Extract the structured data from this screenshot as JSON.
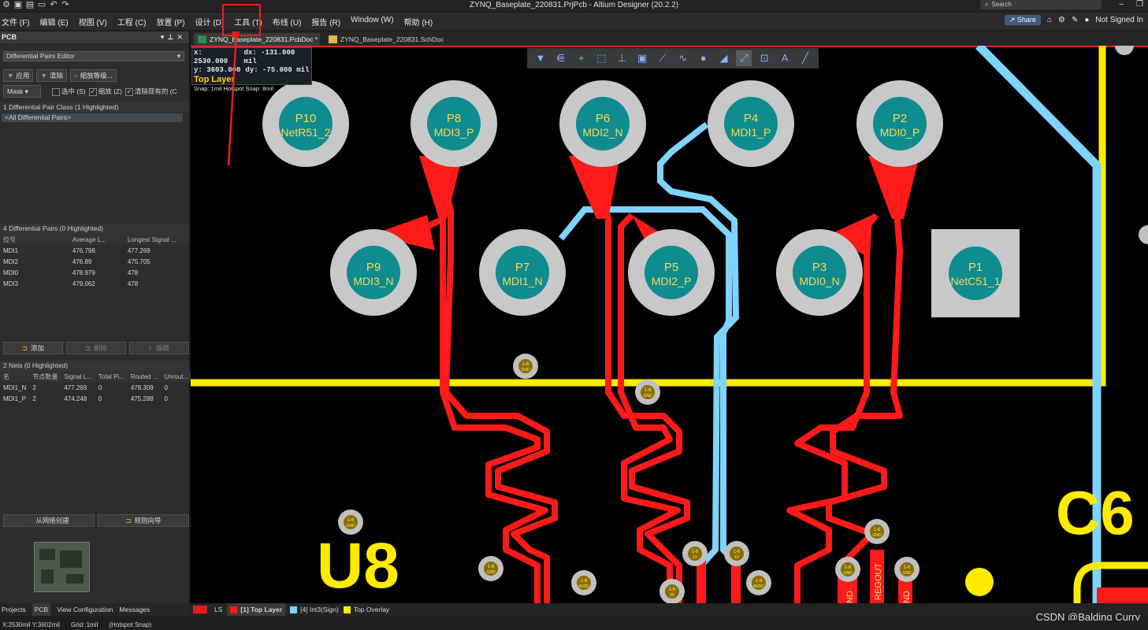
{
  "app": {
    "title": "ZYNQ_Baseplate_220831.PrjPcb - Altium Designer (20.2.2)",
    "search_placeholder": "Search",
    "share_label": "Share",
    "user_label": "Not Signed In"
  },
  "menu": [
    "文件 (F)",
    "编辑 (E)",
    "视图 (V)",
    "工程 (C)",
    "放置 (P)",
    "设计 (D)",
    "工具 (T)",
    "布线 (U)",
    "报告 (R)",
    "Window (W)",
    "帮助 (H)"
  ],
  "panel": {
    "title": "PCB",
    "mode": "Differential Pairs Editor",
    "apply_label": "应用",
    "clear_label": "清除",
    "zoom_label": "缩放等级...",
    "mask_label": "Mask",
    "select_label": "选中 (S)",
    "zoom_chk_label": "缩放 (Z)",
    "clear_existing_label": "清除现有的 (C",
    "class_header": "1 Differential Pair Class (1 Highlighted)",
    "class_item": "<All Differential Pairs>",
    "pairs_header": "4 Differential Pairs (0 Highlighted)",
    "pairs_cols": [
      "位号",
      "Average L...",
      "Longest Signal ..."
    ],
    "pairs": [
      {
        "name": "MDI1",
        "avg": "476.798",
        "longest": "477.269"
      },
      {
        "name": "MDI2",
        "avg": "476.89",
        "longest": "475.705"
      },
      {
        "name": "MDI0",
        "avg": "478.979",
        "longest": "478"
      },
      {
        "name": "MDI3",
        "avg": "479.062",
        "longest": "478"
      }
    ],
    "add_label": "添加",
    "btn2_label": "删除",
    "btn3_label": "编辑",
    "nets_header": "2 Nets (0 Highlighted)",
    "nets_cols": [
      "名",
      "节点数量",
      "Signal L...",
      "Total Pi...",
      "Routed ...",
      "Unrout..."
    ],
    "nets": [
      {
        "name": "MDI1_N",
        "nodes": "2",
        "signal": "477.269",
        "total": "0",
        "routed": "478.309",
        "unrouted": "0"
      },
      {
        "name": "MDI1_P",
        "nodes": "2",
        "signal": "474.248",
        "total": "0",
        "routed": "475.288",
        "unrouted": "0"
      }
    ],
    "from_net_label": "从网络创建",
    "rule_wizard_label": "规则向导"
  },
  "left_tabs": [
    "Projects",
    "PCB",
    "View Configuration",
    "Messages"
  ],
  "doc_tabs": [
    "ZYNQ_Baseplate_220831.PcbDoc *",
    "ZYNQ_Baseplate_220831.SchDoc"
  ],
  "coords": {
    "x": "x: 2530.000",
    "dx": "dx: -131.000 mil",
    "y": "y: 3603.000",
    "dy": "dy:  -75.000 mil",
    "layer": "Top Layer",
    "snap": "Snap: 1mil Hotspot Snap: 8mil"
  },
  "layers": {
    "ls_label": "LS",
    "top": "[1] Top Layer",
    "int3": "[4] Int3(Sign)",
    "overlay": "Top Overlay",
    "colors": {
      "top": "#ff1a1a",
      "int3": "#7fd3ff",
      "overlay": "#ffeb00"
    }
  },
  "status": {
    "pos": "X:2530mil Y:3602mil",
    "grid": "Grid: 1mil",
    "snap": "(Hotspot Snap)"
  },
  "pads_top": [
    {
      "num": "P10",
      "net": "NetR51_2"
    },
    {
      "num": "P8",
      "net": "MDI3_P"
    },
    {
      "num": "P6",
      "net": "MDI2_N"
    },
    {
      "num": "P4",
      "net": "MDI1_P"
    },
    {
      "num": "P2",
      "net": "MDI0_P"
    }
  ],
  "pads_bottom": [
    {
      "num": "P9",
      "net": "MDI3_N"
    },
    {
      "num": "P7",
      "net": "MDI1_N"
    },
    {
      "num": "P5",
      "net": "MDI2_P"
    },
    {
      "num": "P3",
      "net": "MDI0_N"
    },
    {
      "num": "P1",
      "net": "NetC51_1"
    }
  ],
  "silk": {
    "u8": "U8",
    "c6": "C6"
  },
  "via_label": "1-6",
  "via_nets": [
    "GND",
    "GND",
    "GND",
    "1V",
    "1V",
    "GND",
    "AVDD",
    "3V",
    "AVDD",
    "GND",
    "GND",
    "GND"
  ],
  "bottom_labels": [
    "ND",
    "REGOUT",
    "ND"
  ],
  "watermark": "CSDN @Balding Curry"
}
